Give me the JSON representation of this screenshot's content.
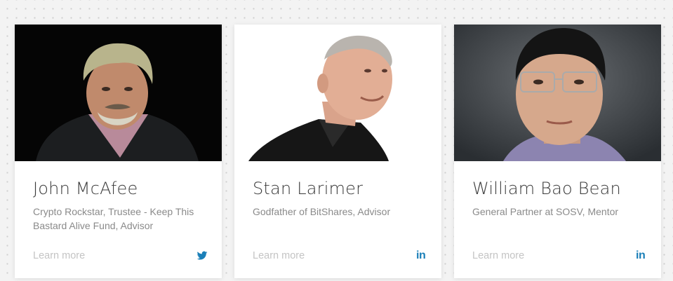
{
  "advisors": [
    {
      "name": "John McAfee",
      "role": "Crypto Rockstar, Trustee - Keep This Bastard Alive Fund, Advisor",
      "link_label": "Learn more",
      "social_icon": "twitter-icon"
    },
    {
      "name": "Stan Larimer",
      "role": "Godfather of BitShares, Advisor",
      "link_label": "Learn more",
      "social_icon": "linkedin-icon"
    },
    {
      "name": "William Bao Bean",
      "role": "General Partner at SOSV, Mentor",
      "link_label": "Learn more",
      "social_icon": "linkedin-icon"
    }
  ],
  "colors": {
    "social_blue": "#1a7fb8",
    "link_gray": "#c4c4c4",
    "name_text": "#3a3a3a",
    "role_text": "#8a8a8a"
  }
}
